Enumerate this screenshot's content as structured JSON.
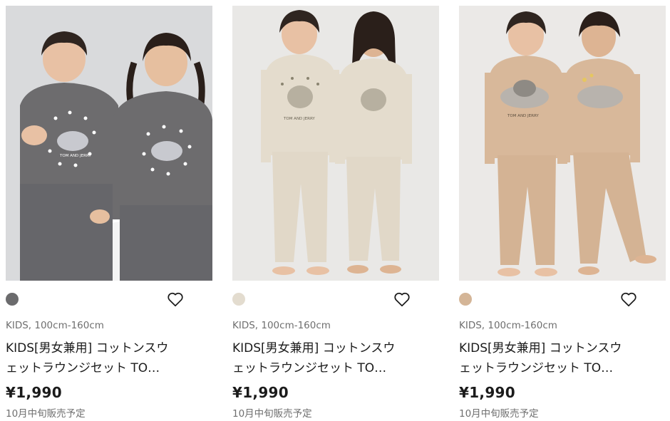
{
  "products": [
    {
      "swatch_color": "#6b6b6d",
      "shirt_color": "#6d6c6e",
      "category": "KIDS, 100cm-160cm",
      "title_line1": "KIDS[男女兼用] コットンスウ",
      "title_line2": "ェットラウンジセット TO…",
      "price": "¥1,990",
      "release": "10月中旬販売予定",
      "print_text": "TOM AND JERRY",
      "background": "#d9dadc"
    },
    {
      "swatch_color": "#e3dccf",
      "shirt_color": "#e4dccd",
      "category": "KIDS, 100cm-160cm",
      "title_line1": "KIDS[男女兼用] コットンスウ",
      "title_line2": "ェットラウンジセット TO…",
      "price": "¥1,990",
      "release": "10月中旬販売予定",
      "print_text": "TOM AND JERRY",
      "background": "#e9e8e6"
    },
    {
      "swatch_color": "#d4b597",
      "shirt_color": "#d8b89a",
      "category": "KIDS, 100cm-160cm",
      "title_line1": "KIDS[男女兼用] コットンスウ",
      "title_line2": "ェットラウンジセット TO…",
      "price": "¥1,990",
      "release": "10月中旬販売予定",
      "print_text": "TOM AND JERRY",
      "background": "#ebe9e7"
    }
  ],
  "icons": {
    "favorite": "heart-outline-icon"
  }
}
